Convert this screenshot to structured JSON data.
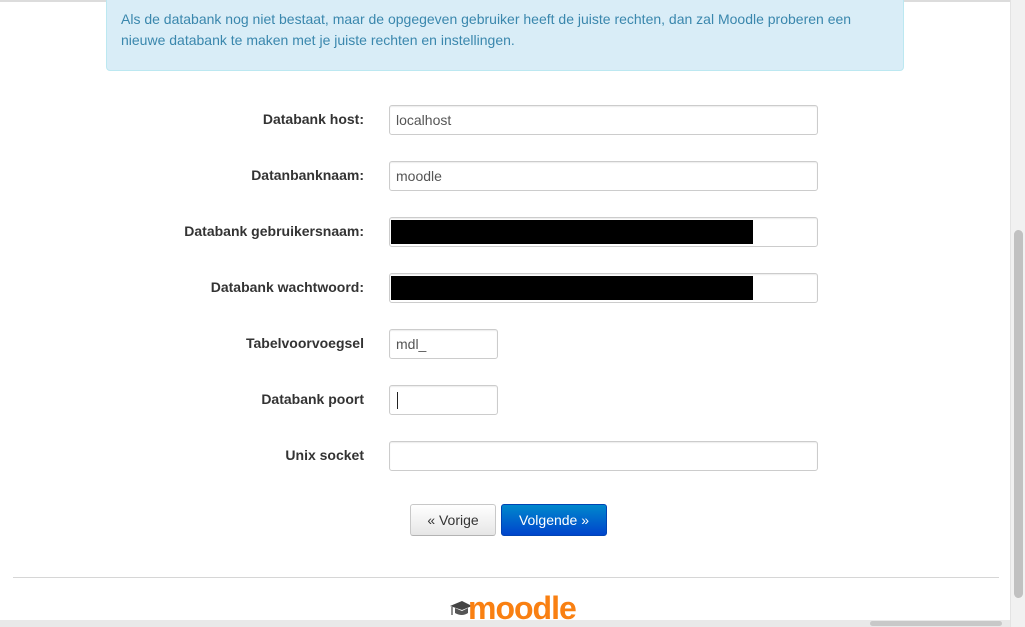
{
  "notice": {
    "text": "Als de databank nog niet bestaat, maar de opgegeven gebruiker heeft de juiste rechten, dan zal Moodle proberen een nieuwe databank te maken met je juiste rechten en instellingen."
  },
  "form": {
    "fields": [
      {
        "label": "Databank host:",
        "value": "localhost"
      },
      {
        "label": "Datanbanknaam:",
        "value": "moodle"
      },
      {
        "label": "Databank gebruikersnaam:",
        "value": ""
      },
      {
        "label": "Databank wachtwoord:",
        "value": ""
      },
      {
        "label": "Tabelvoorvoegsel",
        "value": "mdl_"
      },
      {
        "label": "Databank poort",
        "value": ""
      },
      {
        "label": "Unix socket",
        "value": ""
      }
    ]
  },
  "buttons": {
    "previous": "« Vorige",
    "next": "Volgende »"
  },
  "footer": {
    "logo_text": "moodle",
    "logo_color": "#f98012"
  },
  "colors": {
    "notice_bg": "#d9edf7",
    "notice_text": "#3a87ad",
    "primary_button": "#0055cc"
  }
}
